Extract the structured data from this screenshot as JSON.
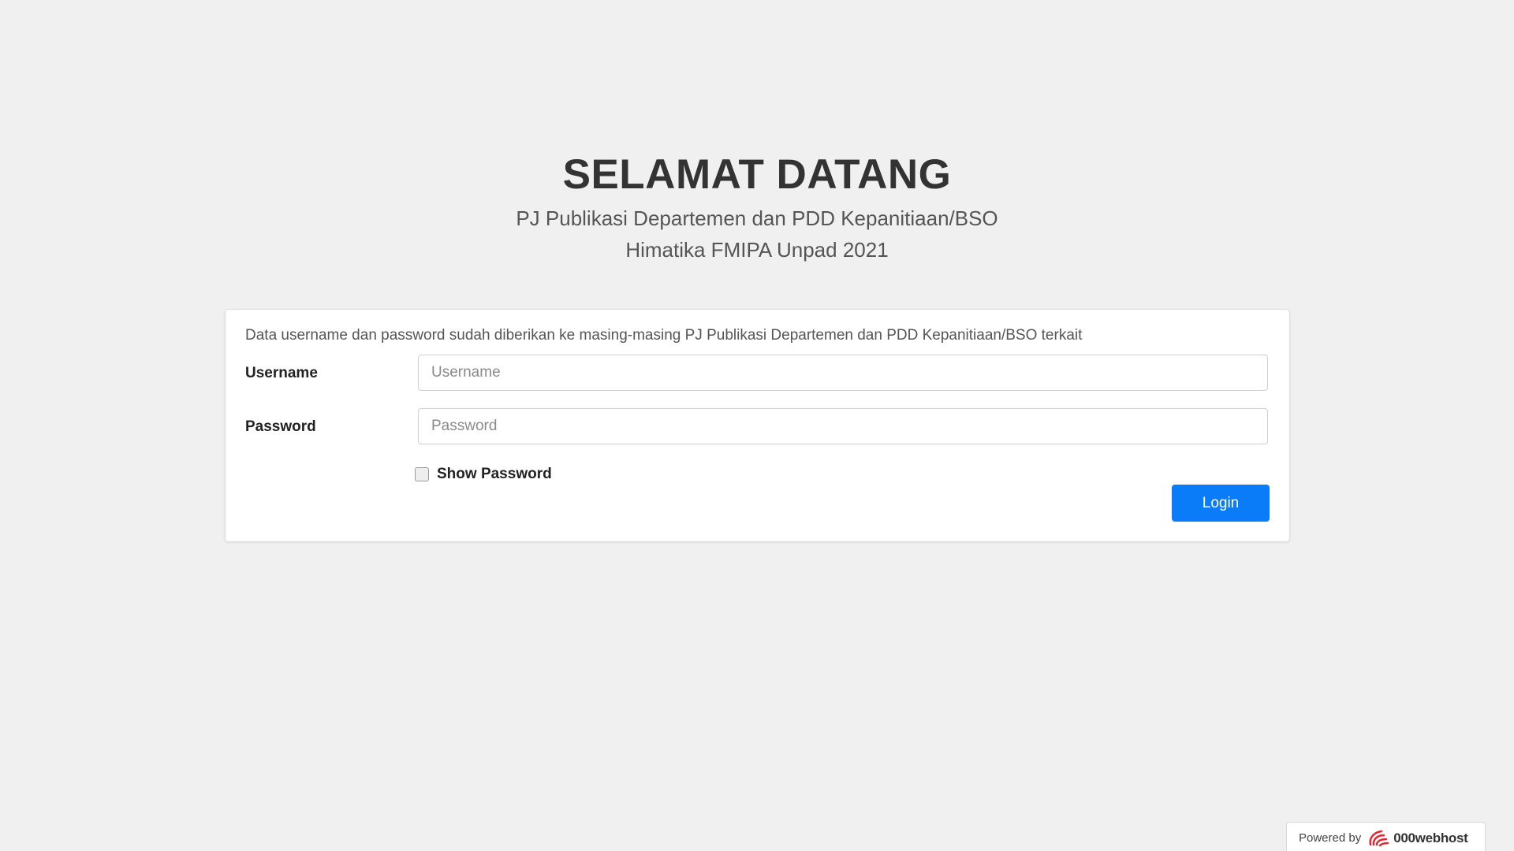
{
  "header": {
    "title": "SELAMAT DATANG",
    "subtitle_line1": "PJ Publikasi Departemen dan PDD Kepanitiaan/BSO",
    "subtitle_line2": "Himatika FMIPA Unpad 2021"
  },
  "form": {
    "info_text": "Data username dan password sudah diberikan ke masing-masing PJ Publikasi Departemen dan PDD Kepanitiaan/BSO terkait",
    "username_label": "Username",
    "username_placeholder": "Username",
    "username_value": "",
    "password_label": "Password",
    "password_placeholder": "Password",
    "password_value": "",
    "show_password_label": "Show Password",
    "show_password_checked": false,
    "login_label": "Login"
  },
  "footer": {
    "powered_by": "Powered by",
    "brand": "000webhost",
    "brand_icon": "000webhost-logo-icon"
  },
  "colors": {
    "background": "#f0f0f0",
    "primary_button": "#0a7cf7",
    "brand_red": "#e8212b"
  }
}
